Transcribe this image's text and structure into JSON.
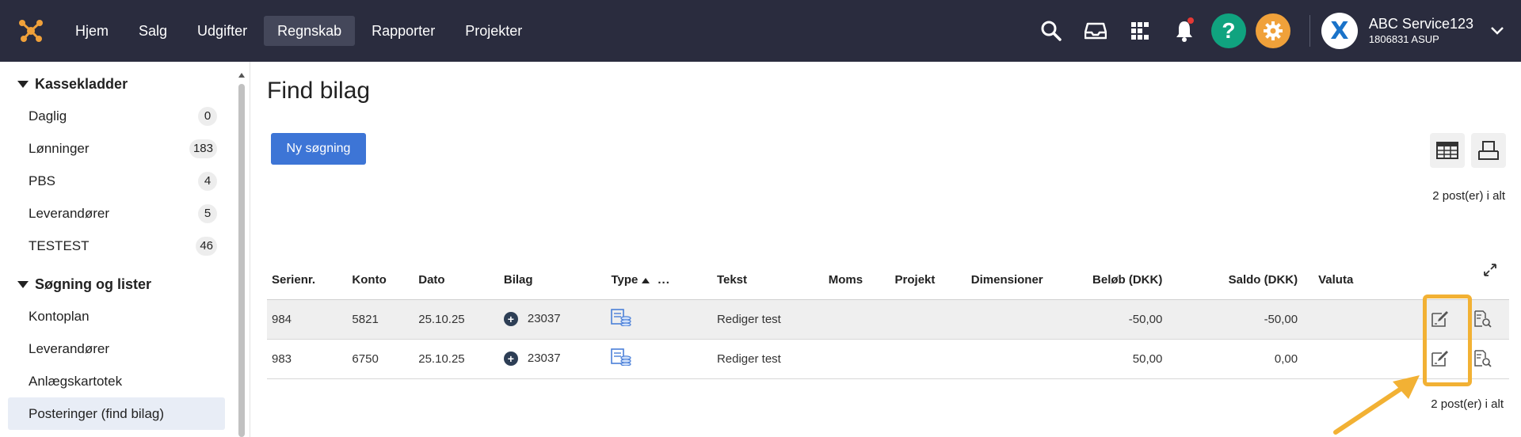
{
  "nav": {
    "items": [
      {
        "label": "Hjem"
      },
      {
        "label": "Salg"
      },
      {
        "label": "Udgifter"
      },
      {
        "label": "Regnskab"
      },
      {
        "label": "Rapporter"
      },
      {
        "label": "Projekter"
      }
    ],
    "active": "Regnskab"
  },
  "company": {
    "name": "ABC Service123",
    "id": "1806831 ASUP",
    "avatar_letter": "X"
  },
  "icons": {
    "help": "?",
    "notification_dot_color": "#e53935"
  },
  "sidebar": {
    "sections": [
      {
        "title": "Kassekladder",
        "items": [
          {
            "label": "Daglig",
            "count": "0"
          },
          {
            "label": "Lønninger",
            "count": "183"
          },
          {
            "label": "PBS",
            "count": "4"
          },
          {
            "label": "Leverandører",
            "count": "5"
          },
          {
            "label": "TESTEST",
            "count": "46"
          }
        ]
      },
      {
        "title": "Søgning og lister",
        "items": [
          {
            "label": "Kontoplan"
          },
          {
            "label": "Leverandører"
          },
          {
            "label": "Anlægskartotek"
          },
          {
            "label": "Posteringer (find bilag)"
          }
        ]
      }
    ]
  },
  "main": {
    "title": "Find bilag",
    "new_search_label": "Ny søgning",
    "count_top": "2 post(er) i alt",
    "count_bottom": "2 post(er) i alt"
  },
  "table": {
    "headers": {
      "serienr": "Serienr.",
      "konto": "Konto",
      "dato": "Dato",
      "bilag": "Bilag",
      "type": "Type",
      "more": "...",
      "tekst": "Tekst",
      "moms": "Moms",
      "projekt": "Projekt",
      "dimensioner": "Dimensioner",
      "belob": "Beløb (DKK)",
      "saldo": "Saldo (DKK)",
      "valuta": "Valuta"
    },
    "rows": [
      {
        "serienr": "984",
        "konto": "5821",
        "dato": "25.10.25",
        "bilag": "23037",
        "tekst": "Rediger test",
        "moms": "",
        "projekt": "",
        "dimensioner": "",
        "belob": "-50,00",
        "saldo": "-50,00",
        "valuta": ""
      },
      {
        "serienr": "983",
        "konto": "6750",
        "dato": "25.10.25",
        "bilag": "23037",
        "tekst": "Rediger test",
        "moms": "",
        "projekt": "",
        "dimensioner": "",
        "belob": "50,00",
        "saldo": "0,00",
        "valuta": ""
      }
    ]
  },
  "colors": {
    "topbar": "#2a2c3e",
    "primary": "#3d75d6",
    "highlight": "#f2b134",
    "help": "#10a37f",
    "gear": "#f0a13a"
  }
}
